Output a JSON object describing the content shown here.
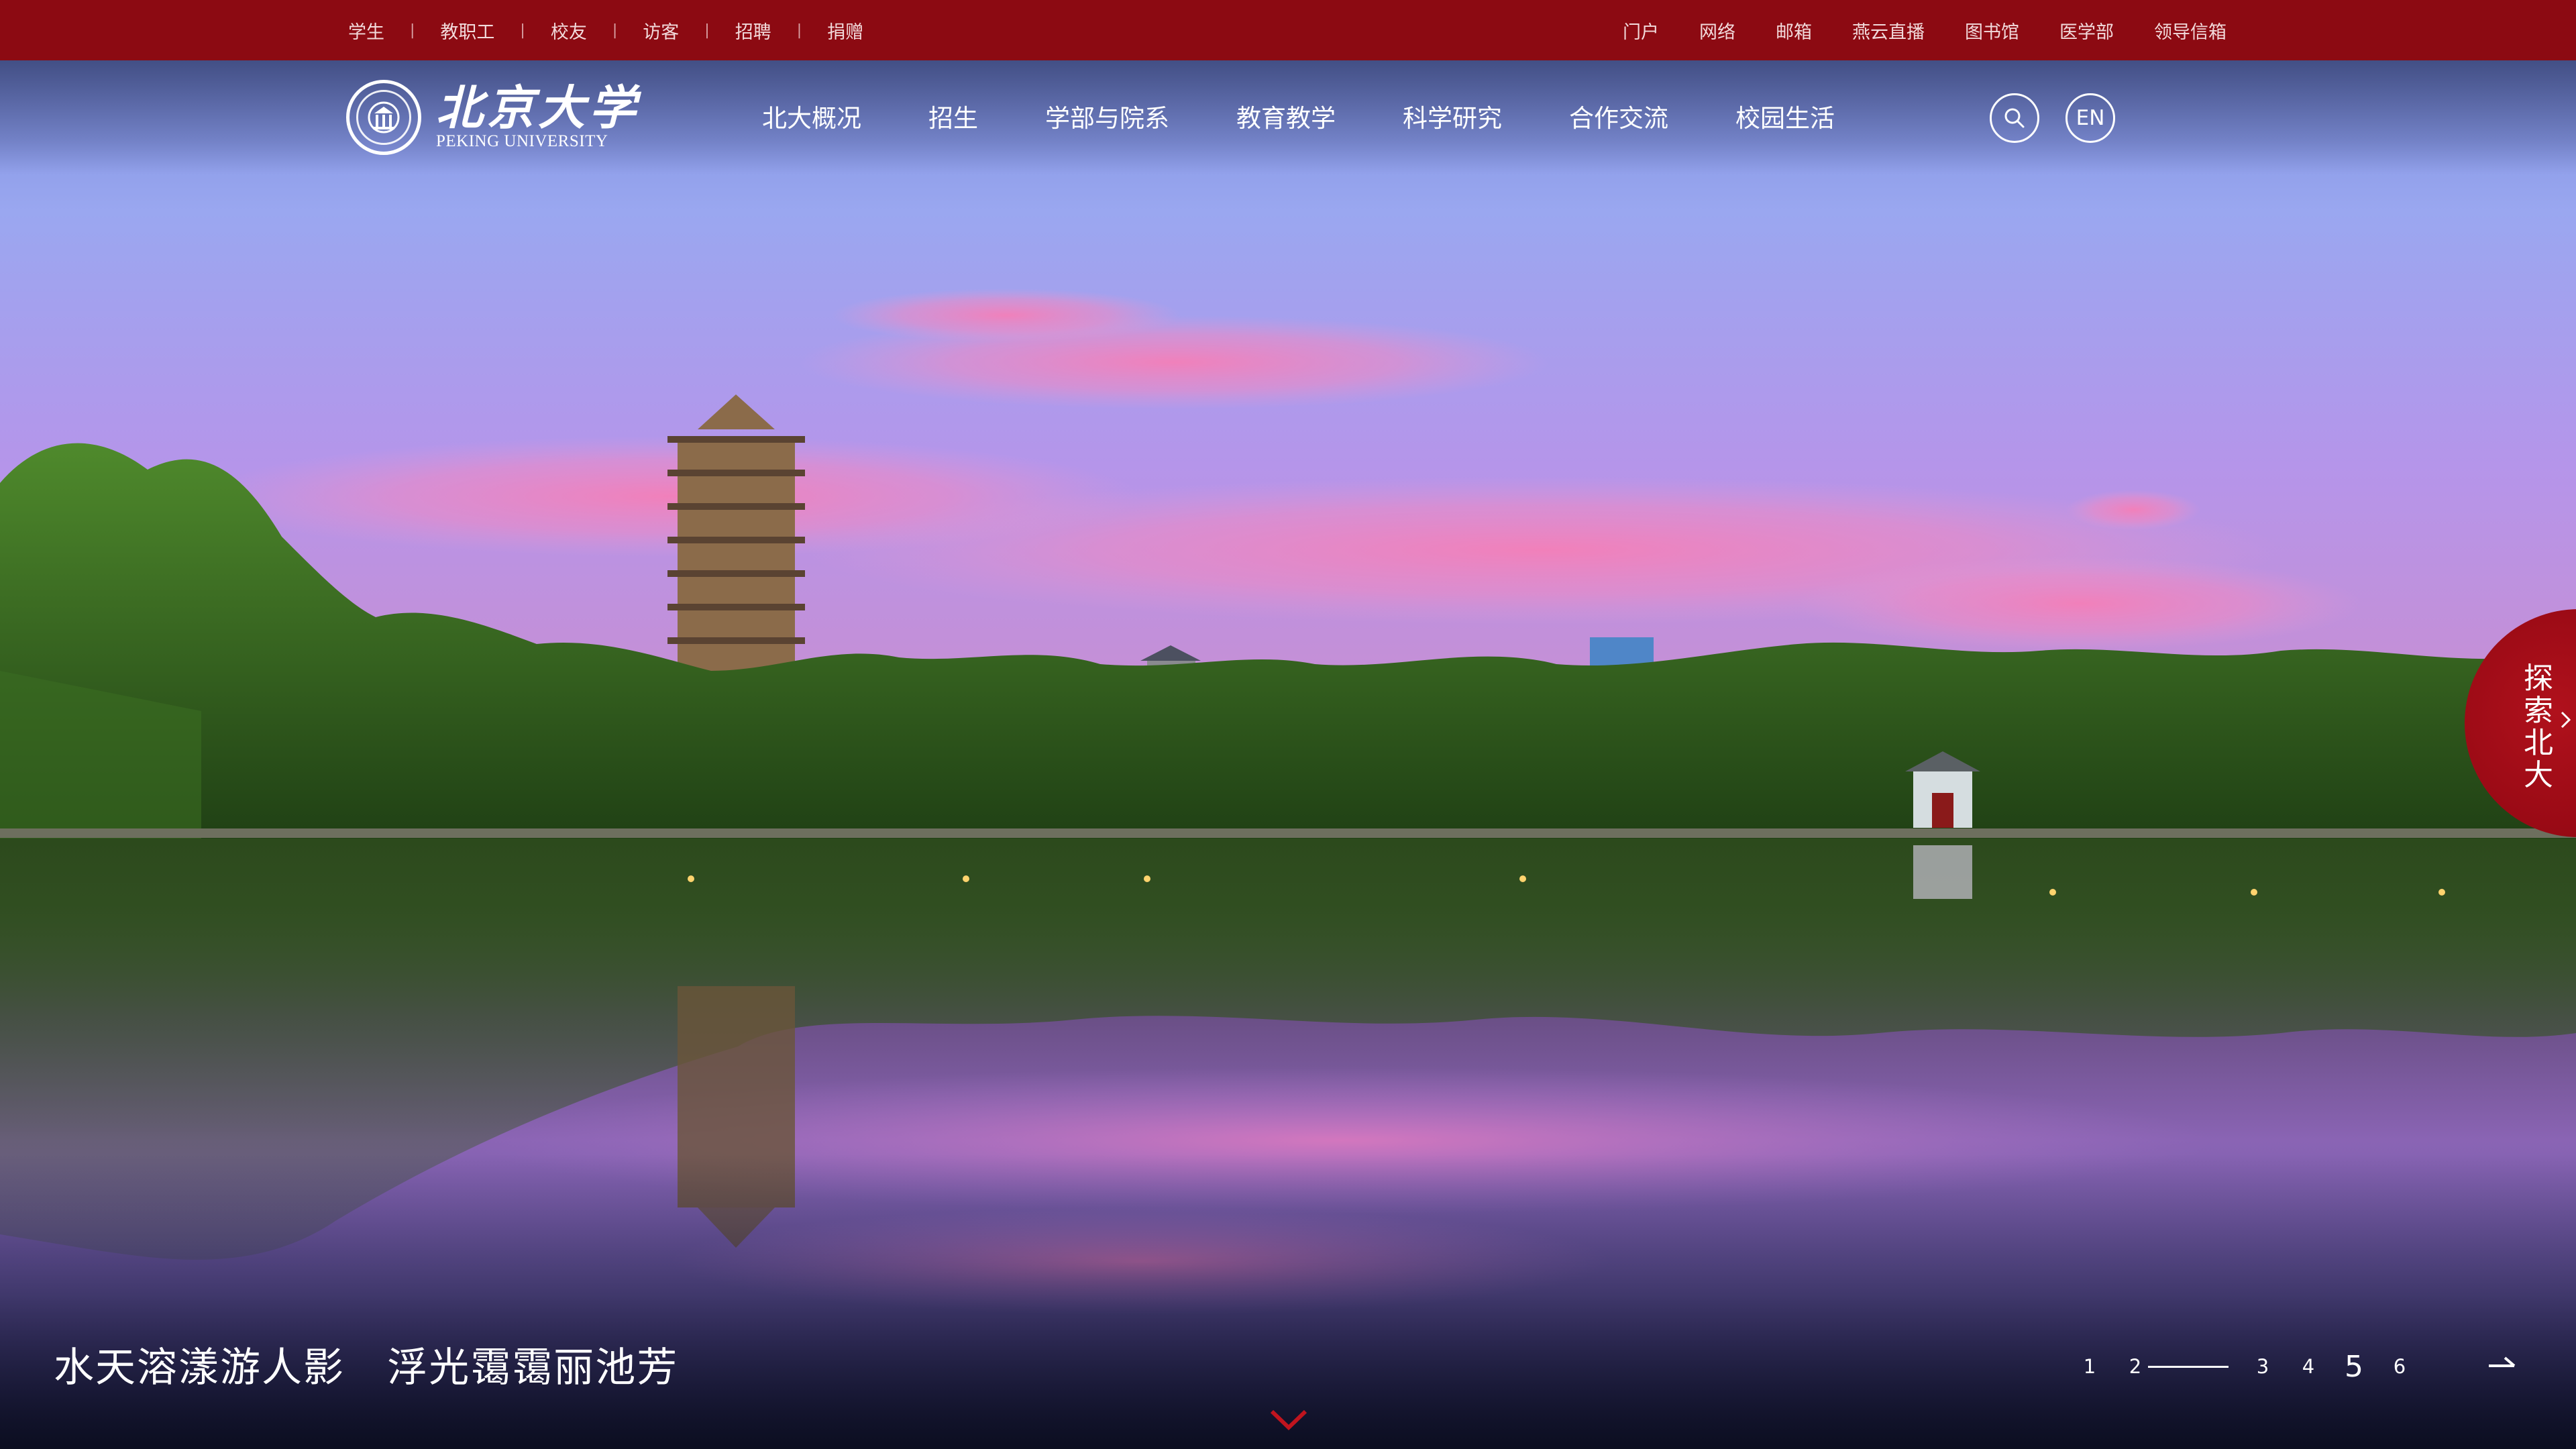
{
  "topbar": {
    "left_links": [
      "学生",
      "教职工",
      "校友",
      "访客",
      "招聘",
      "捐赠"
    ],
    "separator": "|",
    "right_links": [
      "门户",
      "网络",
      "邮箱",
      "燕云直播",
      "图书馆",
      "医学部",
      "领导信箱"
    ]
  },
  "logo": {
    "cn": "北京大学",
    "en": "PEKING UNIVERSITY"
  },
  "nav": {
    "items": [
      "北大概况",
      "招生",
      "学部与院系",
      "教育教学",
      "科学研究",
      "合作交流",
      "校园生活"
    ],
    "search_icon": "search-icon",
    "lang_label": "EN"
  },
  "explore": {
    "label": "探索北大",
    "icon": "chevron-right-icon",
    "color": "#9a0a15"
  },
  "hero": {
    "caption": "水天溶漾游人影   浮光霭霭丽池芳"
  },
  "slider": {
    "pages": [
      "1",
      "2",
      "3",
      "4",
      "5",
      "6"
    ],
    "active_page": "5",
    "next_icon": "arrow-right-icon",
    "scroll_icon": "chevron-down-icon"
  },
  "colors": {
    "brand_red": "#8c0a12",
    "accent_red": "#c0141e"
  }
}
